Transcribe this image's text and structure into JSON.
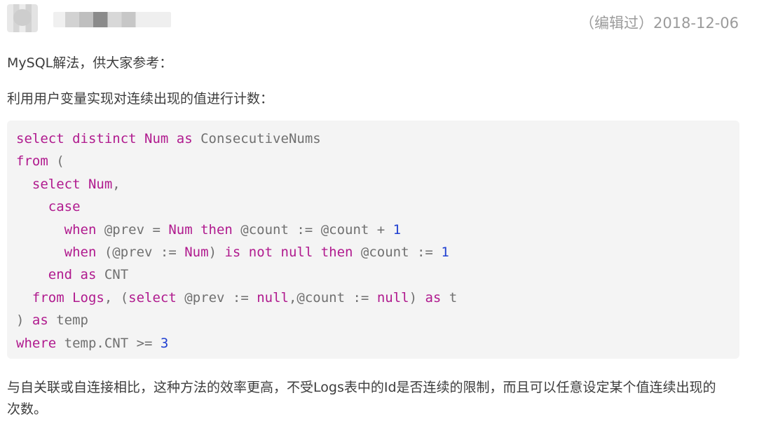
{
  "post": {
    "edited_date": "（编辑过）2018-12-06",
    "intro_1": "MySQL解法，供大家参考：",
    "intro_2": "利用用户变量实现对连续出现的值进行计数：",
    "outro_1": "与自关联或自连接相比，这种方法的效率更高，不受Logs表中的Id是否连续的限制，而且可以任意设定某个值连续出现的",
    "outro_2": "次数。"
  },
  "code": {
    "lines": [
      [
        {
          "t": "select distinct Num as ",
          "c": "k"
        },
        {
          "t": "ConsecutiveNums",
          "c": "plain"
        }
      ],
      [
        {
          "t": "from",
          "c": "k"
        },
        {
          "t": " (",
          "c": "plain"
        }
      ],
      [
        {
          "t": "  select Num",
          "c": "k"
        },
        {
          "t": ",",
          "c": "plain"
        }
      ],
      [
        {
          "t": "    case",
          "c": "k"
        }
      ],
      [
        {
          "t": "      when",
          "c": "k"
        },
        {
          "t": " @prev = ",
          "c": "plain"
        },
        {
          "t": "Num then",
          "c": "k"
        },
        {
          "t": " @count := @count + ",
          "c": "plain"
        },
        {
          "t": "1",
          "c": "num"
        }
      ],
      [
        {
          "t": "      when",
          "c": "k"
        },
        {
          "t": " (@prev := ",
          "c": "plain"
        },
        {
          "t": "Num",
          "c": "k"
        },
        {
          "t": ") ",
          "c": "plain"
        },
        {
          "t": "is not null then",
          "c": "k"
        },
        {
          "t": " @count := ",
          "c": "plain"
        },
        {
          "t": "1",
          "c": "num"
        }
      ],
      [
        {
          "t": "    end as ",
          "c": "k"
        },
        {
          "t": "CNT",
          "c": "plain"
        }
      ],
      [
        {
          "t": "  from Logs",
          "c": "k"
        },
        {
          "t": ", (",
          "c": "plain"
        },
        {
          "t": "select",
          "c": "k"
        },
        {
          "t": " @prev := ",
          "c": "plain"
        },
        {
          "t": "null",
          "c": "k"
        },
        {
          "t": ",@count := ",
          "c": "plain"
        },
        {
          "t": "null",
          "c": "k"
        },
        {
          "t": ") ",
          "c": "plain"
        },
        {
          "t": "as",
          "c": "k"
        },
        {
          "t": " t",
          "c": "plain"
        }
      ],
      [
        {
          "t": ") ",
          "c": "plain"
        },
        {
          "t": "as",
          "c": "k"
        },
        {
          "t": " temp",
          "c": "plain"
        }
      ],
      [
        {
          "t": "where",
          "c": "k"
        },
        {
          "t": " temp.CNT >= ",
          "c": "plain"
        },
        {
          "t": "3",
          "c": "num"
        }
      ]
    ]
  }
}
